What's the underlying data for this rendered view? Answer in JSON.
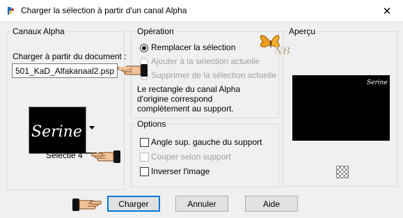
{
  "window": {
    "title": "Charger la sélection à partir d'un canal Alpha",
    "close_glyph": "✕"
  },
  "canaux": {
    "legend": "Canaux Alpha",
    "doc_label": "Charger à partir du document :",
    "doc_value": "501_KaD_Alfakanaal2.psp",
    "channel_name": "Selectie 4",
    "swatch_text": "Serine"
  },
  "operation": {
    "legend": "Opération",
    "radios": [
      {
        "label": "Remplacer la sélection",
        "checked": true,
        "enabled": true
      },
      {
        "label": "Ajouter à la sélection actuelle",
        "checked": false,
        "enabled": false
      },
      {
        "label": "Supprimer de la sélection actuelle",
        "checked": false,
        "enabled": false
      }
    ],
    "description": [
      "Le rectangle du canal Alpha",
      "d'origine correspond",
      "complètement au support."
    ]
  },
  "options": {
    "legend": "Options",
    "checkboxes": [
      {
        "label": "Angle sup. gauche du support",
        "checked": false,
        "enabled": true
      },
      {
        "label": "Couper selon support",
        "checked": false,
        "enabled": false
      },
      {
        "label": "Inverser l'image",
        "checked": false,
        "enabled": true
      }
    ]
  },
  "preview": {
    "legend": "Aperçu",
    "preview_text": "Serine"
  },
  "watermark": {
    "text": "NB"
  },
  "buttons": {
    "load": "Charger",
    "cancel": "Annuler",
    "help": "Aide"
  },
  "colors": {
    "accent": "#0078d7",
    "preview_bg": "#000000",
    "dialog_bg": "#f0f0f0"
  }
}
